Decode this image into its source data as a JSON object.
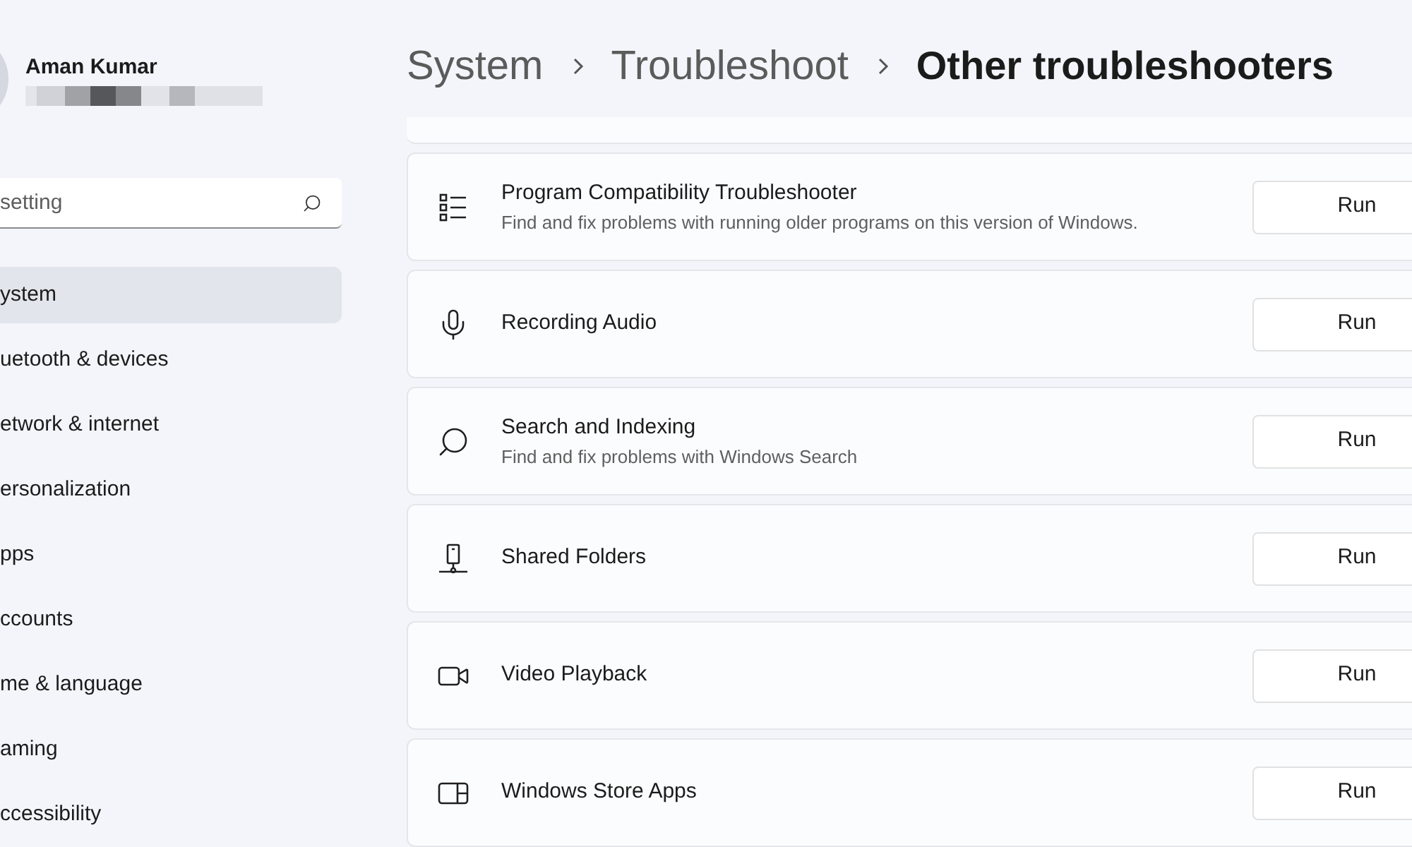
{
  "user": {
    "name": "Aman Kumar"
  },
  "search": {
    "placeholder": "setting"
  },
  "sidebar": {
    "items": [
      {
        "label": "ystem",
        "selected": true
      },
      {
        "label": "uetooth & devices",
        "selected": false
      },
      {
        "label": "etwork & internet",
        "selected": false
      },
      {
        "label": "ersonalization",
        "selected": false
      },
      {
        "label": "pps",
        "selected": false
      },
      {
        "label": "ccounts",
        "selected": false
      },
      {
        "label": "me & language",
        "selected": false
      },
      {
        "label": "aming",
        "selected": false
      },
      {
        "label": "ccessibility",
        "selected": false
      }
    ]
  },
  "breadcrumb": [
    "System",
    "Troubleshoot",
    "Other troubleshooters"
  ],
  "troubleshooters": [
    {
      "kind": "list",
      "title": "Program Compatibility Troubleshooter",
      "description": "Find and fix problems with running older programs on this version of Windows.",
      "button": "Run"
    },
    {
      "kind": "mic",
      "title": "Recording Audio",
      "button": "Run"
    },
    {
      "kind": "search",
      "title": "Search and Indexing",
      "description": "Find and fix problems with Windows Search",
      "button": "Run"
    },
    {
      "kind": "shared",
      "title": "Shared Folders",
      "button": "Run"
    },
    {
      "kind": "video",
      "title": "Video Playback",
      "button": "Run"
    },
    {
      "kind": "store",
      "title": "Windows Store Apps",
      "button": "Run"
    }
  ]
}
